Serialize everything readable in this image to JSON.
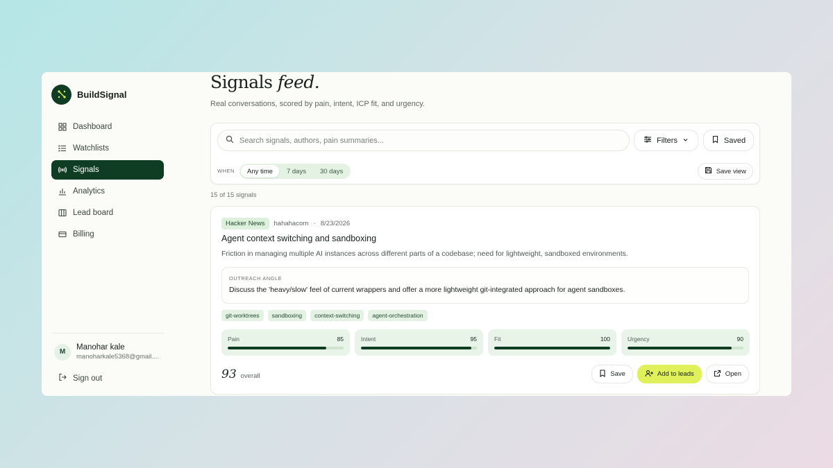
{
  "brand": {
    "name": "BuildSignal"
  },
  "nav": [
    {
      "label": "Dashboard",
      "icon": "dashboard-icon",
      "active": false
    },
    {
      "label": "Watchlists",
      "icon": "list-icon",
      "active": false
    },
    {
      "label": "Signals",
      "icon": "signal-icon",
      "active": true
    },
    {
      "label": "Analytics",
      "icon": "bar-chart-icon",
      "active": false
    },
    {
      "label": "Lead board",
      "icon": "board-icon",
      "active": false
    },
    {
      "label": "Billing",
      "icon": "card-icon",
      "active": false
    }
  ],
  "user": {
    "initial": "M",
    "name": "Manohar kale",
    "email": "manoharkale5368@gmail...."
  },
  "signout": {
    "label": "Sign out"
  },
  "header": {
    "title_main": "Signals",
    "title_em": "feed.",
    "subtitle": "Real conversations, scored by pain, intent, ICP fit, and urgency."
  },
  "toolbar": {
    "search_placeholder": "Search signals, authors, pain summaries...",
    "filters_label": "Filters",
    "saved_label": "Saved",
    "when_label": "WHEN",
    "ranges": [
      "Any time",
      "7 days",
      "30 days"
    ],
    "active_range": "Any time",
    "save_view_label": "Save view"
  },
  "results_count": "15 of 15 signals",
  "signal": {
    "source": "Hacker News",
    "author": "hahahacorn",
    "separator": "·",
    "date": "8/23/2026",
    "title": "Agent context switching and sandboxing",
    "description": "Friction in managing multiple AI instances across different parts of a codebase; need for lightweight, sandboxed environments.",
    "outreach_label": "OUTREACH ANGLE",
    "outreach_text": "Discuss the 'heavy/slow' feel of current wrappers and offer a more lightweight git-integrated approach for agent sandboxes.",
    "tags": [
      "git-worktrees",
      "sandboxing",
      "context-switching",
      "agent-orchestration"
    ],
    "scores": [
      {
        "label": "Pain",
        "value": 85
      },
      {
        "label": "Intent",
        "value": 95
      },
      {
        "label": "Fit",
        "value": 100
      },
      {
        "label": "Urgency",
        "value": 90
      }
    ],
    "overall": "93",
    "overall_label": "overall",
    "actions": {
      "save": "Save",
      "add_leads": "Add to leads",
      "open": "Open"
    }
  },
  "colors": {
    "primary": "#0f3d24",
    "accent": "#dff05a",
    "chip_bg": "#e3f2e3"
  }
}
